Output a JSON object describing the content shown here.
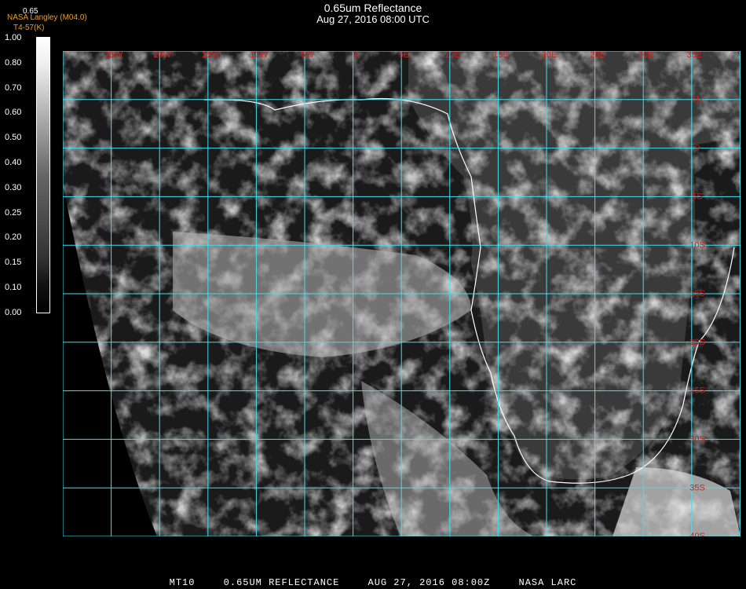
{
  "header": {
    "title": "0.65um Reflectance",
    "datetime": "Aug 27, 2016 08:00 UTC"
  },
  "credit": {
    "band": "0.65",
    "agency": "NASA Langley (M04.0)",
    "note": "T4-57(K)"
  },
  "colorbar": {
    "labels": [
      "1.00",
      "0.80",
      "0.70",
      "0.60",
      "0.50",
      "0.40",
      "0.30",
      "0.25",
      "0.20",
      "0.15",
      "0.10",
      "0.00"
    ]
  },
  "map": {
    "lon_labels": [
      "25W",
      "20W",
      "15W",
      "10W",
      "5W",
      "0",
      "5E",
      "10E",
      "15E",
      "20E",
      "25E",
      "30E",
      "35E"
    ],
    "lat_labels": [
      "5N",
      "0",
      "5S",
      "10S",
      "15S",
      "20S",
      "25S",
      "30S",
      "35S",
      "40S"
    ],
    "gridline_color": "#40e0f0",
    "label_color": "#d02020",
    "coast_color": "#ffffff"
  },
  "footer": {
    "product": "MT10",
    "name": "0.65UM REFLECTANCE",
    "timestamp": "AUG 27, 2016 08:00Z",
    "source": "NASA LARC"
  }
}
